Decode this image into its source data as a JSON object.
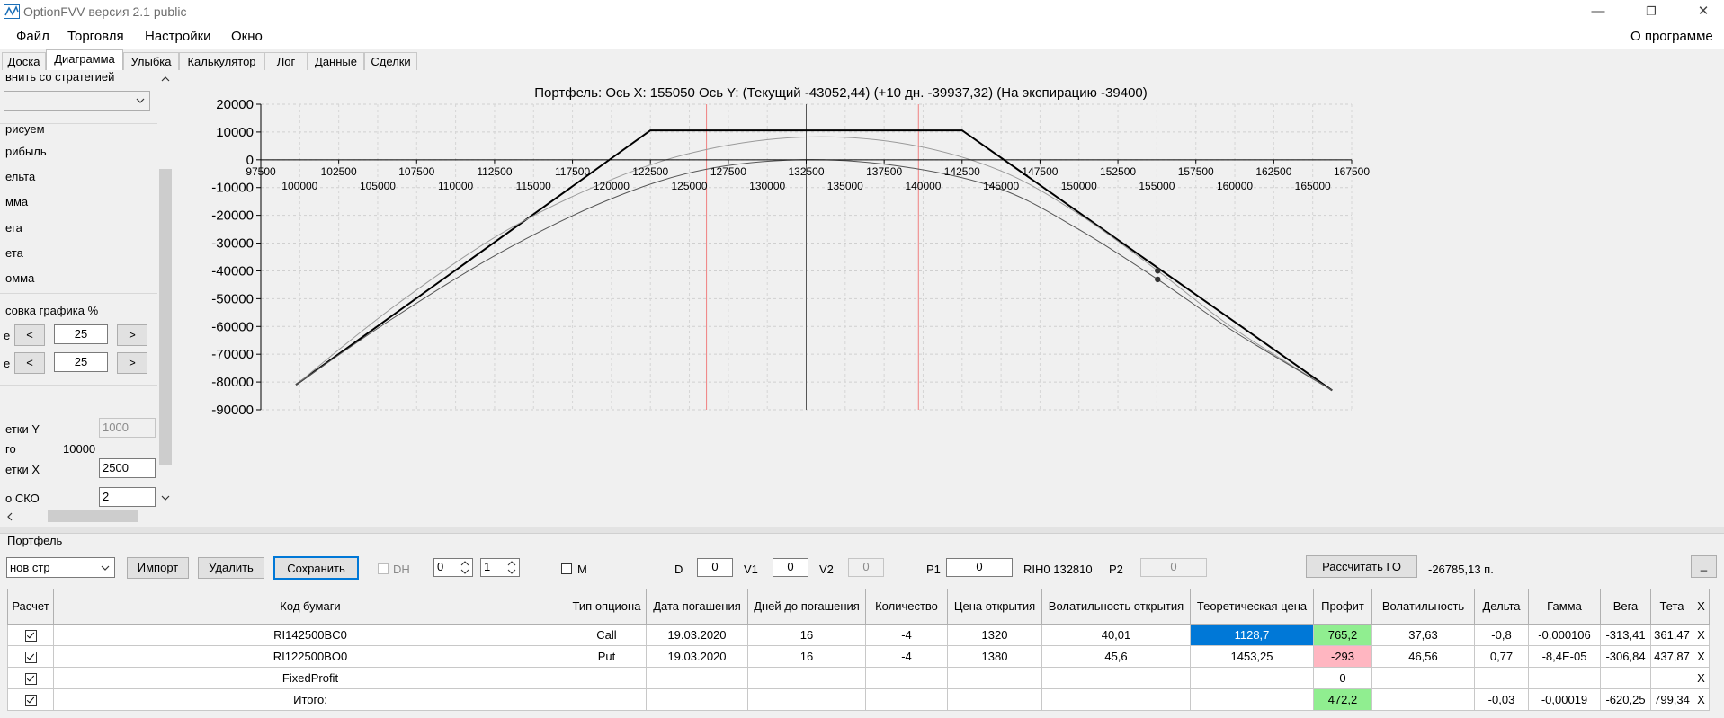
{
  "window": {
    "title": "OptionFVV версия 2.1 public",
    "controls": [
      "—",
      "❐",
      "✕"
    ]
  },
  "menu": {
    "items": [
      "Файл",
      "Торговля",
      "Настройки",
      "Окно"
    ],
    "about": "О программе"
  },
  "tabs": [
    {
      "label": "Доска",
      "active": false
    },
    {
      "label": "Диаграмма",
      "active": true
    },
    {
      "label": "Улыбка",
      "active": false
    },
    {
      "label": "Калькулятор",
      "active": false
    },
    {
      "label": "Лог",
      "active": false
    },
    {
      "label": "Данные",
      "active": false
    },
    {
      "label": "Сделки",
      "active": false
    }
  ],
  "left_panel": {
    "compare_label": "внить со стратегией",
    "draw_label": "рисуем",
    "draw_items": [
      "рибыль",
      "ельта",
      "мма",
      "ега",
      "ета",
      "омма"
    ],
    "scale_label": "совка графика %",
    "scale_rows": [
      {
        "label": "е",
        "minus": "<",
        "value": "25",
        "plus": ">"
      },
      {
        "label": "е",
        "minus": "<",
        "value": "25",
        "plus": ">"
      }
    ],
    "grid_y_label": "етки Y",
    "grid_y_value": "1000",
    "total_label": "го",
    "total_value": "10000",
    "grid_x_label": "етки X",
    "grid_x_value": "2500",
    "sko_label": "о СКО",
    "sko_value": "2"
  },
  "chart_data": {
    "type": "line",
    "title": "Портфель: Ось X: 155050 Ось Y:  (Текущий -43052,44)  (+10 дн. -39937,32)  (На экспирацию -39400)",
    "xlim": [
      97500,
      167500
    ],
    "ylim": [
      -90000,
      20000
    ],
    "y_ticks": [
      20000,
      10000,
      0,
      -10000,
      -20000,
      -30000,
      -40000,
      -50000,
      -60000,
      -70000,
      -80000,
      -90000
    ],
    "x_ticks_upper": [
      97500,
      102500,
      107500,
      112500,
      117500,
      122500,
      127500,
      132500,
      137500,
      142500,
      147500,
      152500,
      157500,
      162500,
      167500
    ],
    "x_ticks_lower": [
      100000,
      105000,
      110000,
      115000,
      120000,
      125000,
      130000,
      135000,
      140000,
      145000,
      150000,
      155000,
      160000,
      165000
    ],
    "vertical_lines": {
      "center": 132500,
      "red": [
        126100,
        139700
      ]
    },
    "series": [
      {
        "x": [
          99750,
          122500,
          142500,
          166250
        ],
        "y": [
          -81000,
          10600,
          10600,
          -83000
        ],
        "color": "#000000",
        "width": 2
      },
      {
        "x": [
          99750,
          106000,
          113000,
          120000,
          126000,
          132500,
          139000,
          145000,
          150000,
          155050,
          160000,
          166250
        ],
        "y": [
          -81000,
          -53000,
          -26300,
          -7100,
          3600,
          8200,
          5600,
          -4000,
          -19600,
          -39937.32,
          -61000,
          -83000
        ],
        "color": "#9a9a9a",
        "width": 1
      },
      {
        "x": [
          99750,
          106000,
          113000,
          120000,
          126000,
          132500,
          139000,
          145000,
          150000,
          155050,
          160000,
          166250
        ],
        "y": [
          -81000,
          -57000,
          -33000,
          -14000,
          -3500,
          0,
          -2700,
          -10600,
          -25100,
          -43052.44,
          -62000,
          -83000
        ],
        "color": "#555555",
        "width": 1
      }
    ],
    "markers": [
      {
        "x": 155050,
        "y": -39937.32
      },
      {
        "x": 155050,
        "y": -43052.44
      }
    ]
  },
  "portfolio": {
    "group_label": "Портфель",
    "strategy_value": "нов стр",
    "import_label": "Импорт",
    "delete_label": "Удалить",
    "save_label": "Сохранить",
    "dh_label": "DH",
    "spin1_value": "0",
    "spin2_value": "1",
    "m_label": "M",
    "d_label": "D",
    "d_value": "0",
    "v1_label": "V1",
    "v1_value": "0",
    "v2_label": "V2",
    "v2_value": "0",
    "p1_label": "P1",
    "p1_value": "0",
    "ticker_text": "RIH0 132810",
    "p2_label": "P2",
    "p2_value": "0",
    "calc_go_label": "Рассчитать ГО",
    "go_value": "-26785,13 п.",
    "minimize_label": "_"
  },
  "table": {
    "headers": [
      "Расчет",
      "Код бумаги",
      "Тип опциона",
      "Дата погашения",
      "Дней до погашения",
      "Количество",
      "Цена открытия",
      "Волатильность открытия",
      "Теоретическая цена",
      "Профит",
      "Волатильность",
      "Дельта",
      "Гамма",
      "Вега",
      "Тета",
      "X"
    ],
    "rows": [
      [
        "",
        "RI142500BC0",
        "Call",
        "19.03.2020",
        "16",
        "-4",
        "1320",
        "40,01",
        "1128,7",
        "765,2",
        "37,63",
        "-0,8",
        "-0,000106",
        "-313,41",
        "361,47",
        "X"
      ],
      [
        "",
        "RI122500BO0",
        "Put",
        "19.03.2020",
        "16",
        "-4",
        "1380",
        "45,6",
        "1453,25",
        "-293",
        "46,56",
        "0,77",
        "-8,4E-05",
        "-306,84",
        "437,87",
        "X"
      ],
      [
        "",
        "FixedProfit",
        "",
        "",
        "",
        "",
        "",
        "",
        "",
        "0",
        "",
        "",
        "",
        "",
        "",
        "X"
      ],
      [
        "",
        "Итого:",
        "",
        "",
        "",
        "",
        "",
        "",
        "",
        "472,2",
        "",
        "-0,03",
        "-0,00019",
        "-620,25",
        "799,34",
        "X"
      ]
    ]
  },
  "colors": {
    "selected_cell": "#0078d7",
    "profit_positive": "#90ee90",
    "profit_negative": "#ffb6c1"
  }
}
